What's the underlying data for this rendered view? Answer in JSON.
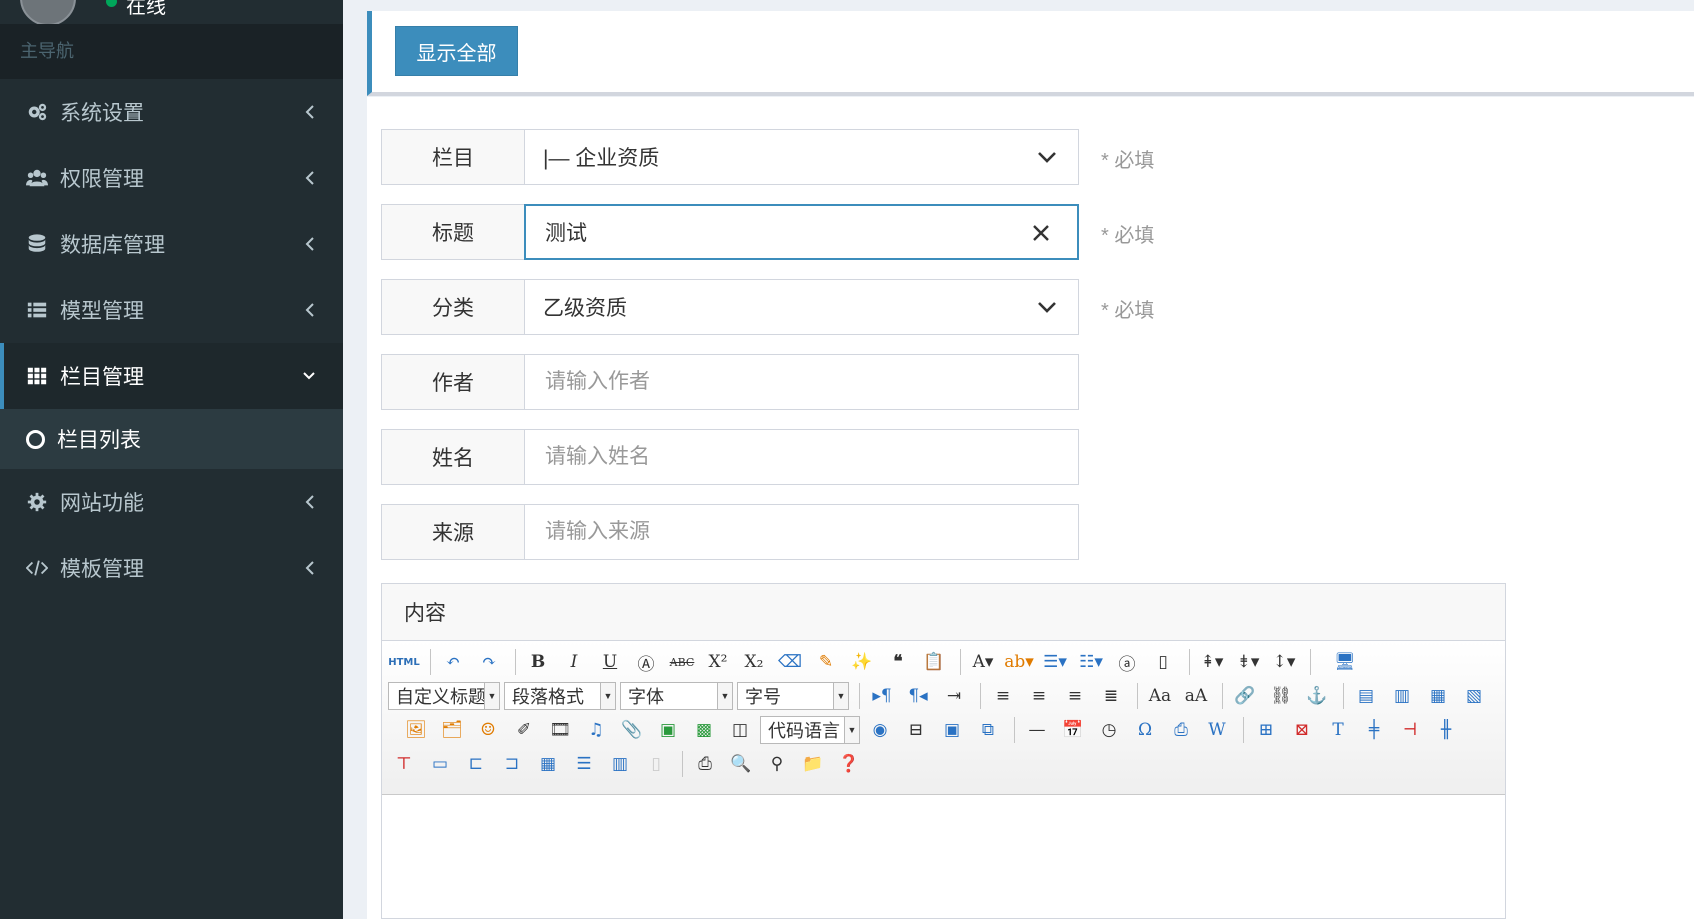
{
  "user": {
    "status": "在线"
  },
  "sidebar": {
    "header": "主导航",
    "items": [
      {
        "label": "系统设置",
        "icon": "cogs-icon"
      },
      {
        "label": "权限管理",
        "icon": "users-icon"
      },
      {
        "label": "数据库管理",
        "icon": "database-icon"
      },
      {
        "label": "模型管理",
        "icon": "list-icon"
      },
      {
        "label": "栏目管理",
        "icon": "grid-icon",
        "active": true
      },
      {
        "label": "网站功能",
        "icon": "gear-icon"
      },
      {
        "label": "模板管理",
        "icon": "code-icon"
      }
    ],
    "submenu": [
      {
        "label": "栏目列表"
      }
    ]
  },
  "topbar": {
    "show_all_label": "显示全部"
  },
  "form": {
    "column": {
      "label": "栏目",
      "value": "|— 企业资质"
    },
    "title": {
      "label": "标题",
      "value": "测试"
    },
    "category": {
      "label": "分类",
      "value": "乙级资质"
    },
    "author": {
      "label": "作者",
      "placeholder": "请输入作者"
    },
    "name": {
      "label": "姓名",
      "placeholder": "请输入姓名"
    },
    "source": {
      "label": "来源",
      "placeholder": "请输入来源"
    },
    "required_hint": "* 必填"
  },
  "editor": {
    "label": "内容",
    "combos": {
      "custom_title": "自定义标题",
      "paragraph": "段落格式",
      "font": "字体",
      "font_size": "字号",
      "code_lang": "代码语言"
    },
    "html_button": "HTML"
  },
  "colors": {
    "accent": "#3c8dbc",
    "sidebar_bg": "#222d32",
    "online": "#00a65a"
  }
}
